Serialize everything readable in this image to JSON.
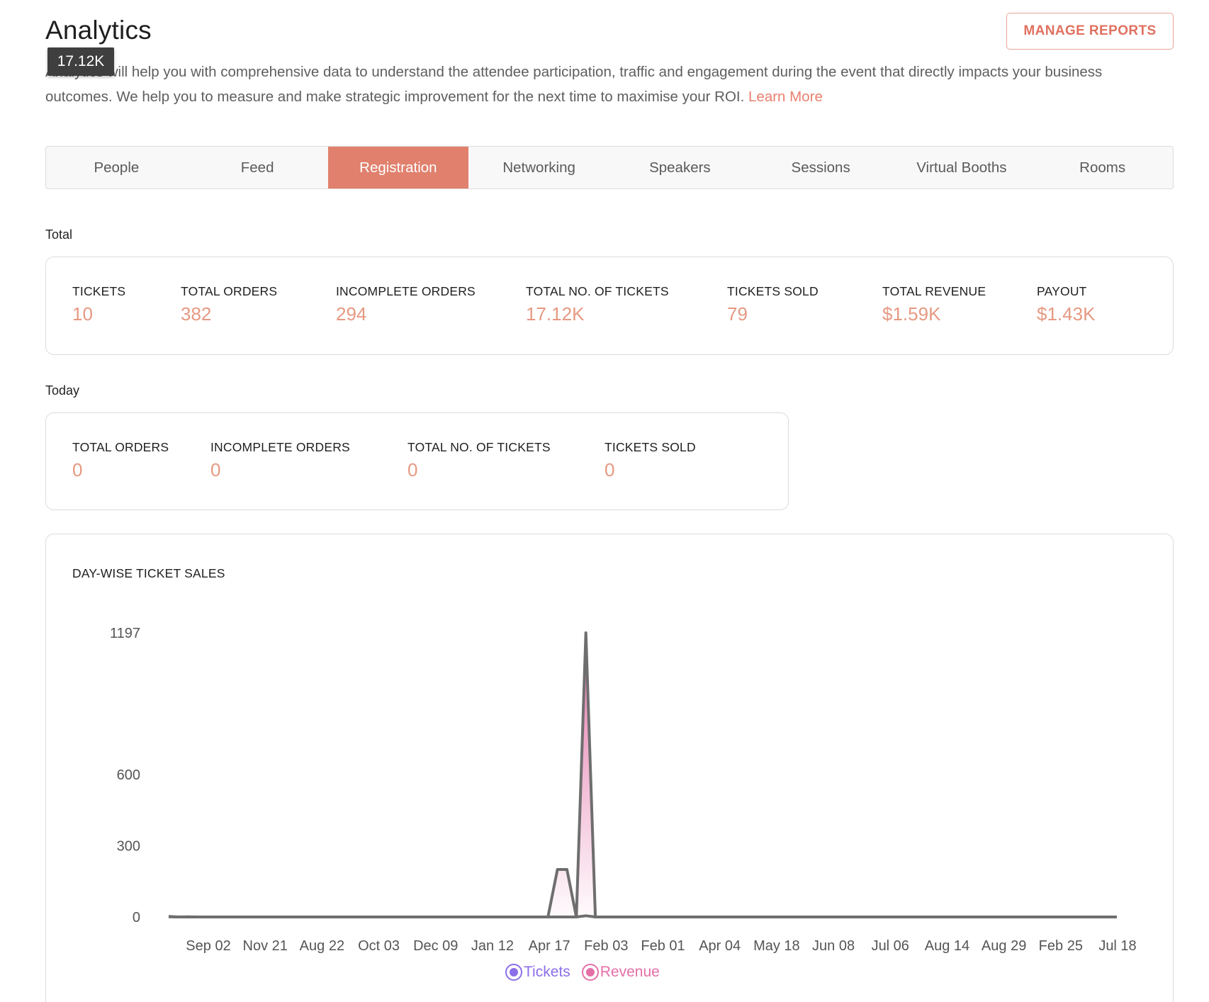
{
  "header": {
    "title": "Analytics",
    "manage_reports_label": "MANAGE REPORTS",
    "tooltip": "17.12K",
    "description": "Analytics will help you with comprehensive data to understand the attendee participation, traffic and engagement during the event that directly impacts your business outcomes. We help you to measure and make strategic improvement for the next time to maximise your ROI.",
    "learn_more": "Learn More"
  },
  "tabs": [
    {
      "label": "People",
      "active": false
    },
    {
      "label": "Feed",
      "active": false
    },
    {
      "label": "Registration",
      "active": true
    },
    {
      "label": "Networking",
      "active": false
    },
    {
      "label": "Speakers",
      "active": false
    },
    {
      "label": "Sessions",
      "active": false
    },
    {
      "label": "Virtual Booths",
      "active": false
    },
    {
      "label": "Rooms",
      "active": false
    }
  ],
  "total": {
    "label": "Total",
    "stats": [
      {
        "label": "TICKETS",
        "value": "10"
      },
      {
        "label": "TOTAL ORDERS",
        "value": "382"
      },
      {
        "label": "INCOMPLETE ORDERS",
        "value": "294"
      },
      {
        "label": "TOTAL NO. OF TICKETS",
        "value": "17.12K"
      },
      {
        "label": "TICKETS SOLD",
        "value": "79"
      },
      {
        "label": "TOTAL REVENUE",
        "value": "$1.59K"
      },
      {
        "label": "PAYOUT",
        "value": "$1.43K"
      }
    ]
  },
  "today": {
    "label": "Today",
    "stats": [
      {
        "label": "TOTAL ORDERS",
        "value": "0"
      },
      {
        "label": "INCOMPLETE ORDERS",
        "value": "0"
      },
      {
        "label": "TOTAL NO. OF TICKETS",
        "value": "0"
      },
      {
        "label": "TICKETS SOLD",
        "value": "0"
      }
    ]
  },
  "colors": {
    "accent": "#e0806d",
    "stat_value": "#e69982",
    "tickets": "#8b6ee8",
    "revenue": "#e46fa7",
    "line": "#6e6e6e"
  },
  "chart_data": {
    "type": "area",
    "title": "DAY-WISE TICKET SALES",
    "y_ticks": [
      0,
      300,
      600,
      1197
    ],
    "ylim": [
      0,
      1197
    ],
    "x_labels": [
      "Sep 02",
      "Nov 21",
      "Aug 22",
      "Oct 03",
      "Dec 09",
      "Jan 12",
      "Apr 17",
      "Feb 03",
      "Feb 01",
      "Apr 04",
      "May 18",
      "Jun 08",
      "Jul 06",
      "Aug 14",
      "Aug 29",
      "Feb 25",
      "Jul 18"
    ],
    "legend_position": "bottom-center",
    "series": [
      {
        "name": "Tickets",
        "color": "#8b6ee8",
        "values": [
          2,
          0,
          1,
          0,
          0,
          0,
          0,
          0,
          0,
          0,
          0,
          0,
          0,
          0,
          0,
          0,
          0,
          0,
          0,
          0,
          0,
          0,
          0,
          0,
          0,
          0,
          0,
          0,
          0,
          0,
          0,
          0,
          0,
          0,
          0,
          0,
          0,
          0,
          0,
          0,
          0,
          200,
          200,
          0,
          1197,
          0,
          0,
          0,
          0,
          0,
          0,
          0,
          0,
          0,
          0,
          0,
          0,
          0,
          0,
          0,
          0,
          0,
          0,
          0,
          0,
          0,
          0,
          0,
          0,
          0,
          0,
          0,
          0,
          0,
          0,
          0,
          0,
          0,
          0,
          0,
          0,
          0,
          0,
          0,
          0,
          0,
          0,
          0,
          0,
          0,
          0,
          0,
          0,
          0,
          0,
          0,
          0,
          0,
          0,
          0,
          0
        ]
      },
      {
        "name": "Revenue",
        "color": "#e46fa7",
        "values": [
          1,
          0,
          0,
          0,
          0,
          0,
          0,
          0,
          0,
          0,
          0,
          0,
          0,
          0,
          0,
          0,
          0,
          0,
          0,
          0,
          0,
          0,
          0,
          0,
          0,
          0,
          0,
          0,
          0,
          0,
          0,
          0,
          0,
          0,
          0,
          0,
          0,
          0,
          0,
          0,
          0,
          0,
          0,
          0,
          5,
          0,
          0,
          0,
          0,
          0,
          0,
          0,
          0,
          0,
          0,
          0,
          0,
          0,
          0,
          0,
          0,
          0,
          0,
          0,
          0,
          0,
          0,
          0,
          0,
          0,
          0,
          0,
          0,
          0,
          0,
          0,
          0,
          0,
          0,
          0,
          0,
          0,
          0,
          0,
          0,
          0,
          0,
          0,
          0,
          0,
          0,
          0,
          0,
          0,
          0,
          0,
          0,
          0,
          0,
          0,
          0
        ]
      }
    ]
  }
}
